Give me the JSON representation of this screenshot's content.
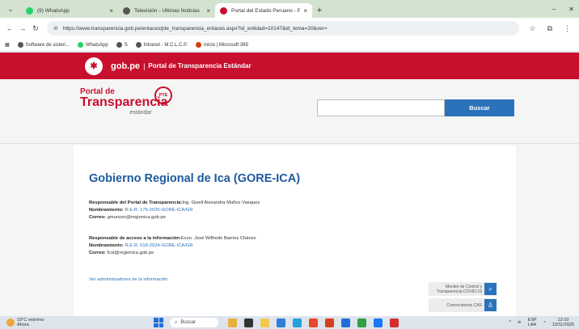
{
  "browser": {
    "tabs": [
      {
        "title": "(9) WhatsApp",
        "active": false,
        "favicon_color": "#25d366"
      },
      {
        "title": "Televisión - Últimas Noticias",
        "active": false,
        "favicon_color": "#555555"
      },
      {
        "title": "Portal del Estado Peruano - Po",
        "active": true,
        "favicon_color": "#c8102e"
      }
    ],
    "new_tab_label": "+",
    "url": "https://www.transparencia.gob.pe/enlaces/pte_transparencia_enlaces.aspx?id_entidad=10147&id_tema=20&ver=",
    "bookmarks": [
      {
        "label": "Software de sisten...",
        "color": "#555555"
      },
      {
        "label": "WhatsApp",
        "color": "#25d366"
      },
      {
        "label": "S",
        "color": "#555555"
      },
      {
        "label": "Intranet - M.C.L.C.P.",
        "color": "#555555"
      },
      {
        "label": "Inicio | Microsoft 365",
        "color": "#d83b01"
      }
    ]
  },
  "site": {
    "gob_brand": "gob.pe",
    "gob_separator": "|",
    "gob_subtitle": "Portal de Transparencia Estándar",
    "logo_line1": "Portal de",
    "logo_line2": "Transparencia",
    "logo_line3": "estándar",
    "logo_badge": "PTE",
    "search_placeholder": "",
    "search_button": "Buscar"
  },
  "entity": {
    "name": "Gobierno Regional de Ica (GORE-ICA)",
    "responsible_portal": {
      "label": "Responsable del Portal de Transparencia:",
      "value": "Ing. Gisell Alexandra Muñoz Vasquez",
      "appointment_label": "Nombramiento:",
      "appointment_value": "R.E.R. 176-2025-GORE-ICA/GR",
      "email_label": "Correo:",
      "email_value": "gmunozv@regionica.gob.pe"
    },
    "responsible_access": {
      "label": "Responsable de acceso a la información:",
      "value": "Econ. José Wilfredo Barrios Chávez",
      "appointment_label": "Nombramiento:",
      "appointment_value": "R.E.R. 018-2024-GORE-ICA/GR",
      "email_label": "Correo:",
      "email_value": "fcst@regionica.gob.pe"
    },
    "admins_link": "Ver administradores de la información"
  },
  "widgets": {
    "monitor_line1": "Monitor de Control y",
    "monitor_line2": "Transparencia COVID-19",
    "convocatorias": "Convocatorias CAS"
  },
  "taskbar": {
    "weather_line1": "19°C extremo",
    "weather_line2": "Ahora",
    "search_label": "Buscar",
    "lang_line1": "ESP",
    "lang_line2": "LAA",
    "time": "12:10",
    "date": "13/11/2025",
    "app_colors": [
      "#e7b03d",
      "#333333",
      "#f2c94c",
      "#2f7ed8",
      "#24a1de",
      "#e34b2c",
      "#d4401f",
      "#1e6fd9",
      "#2f9e44",
      "#1877f2",
      "#d32f2f"
    ]
  }
}
